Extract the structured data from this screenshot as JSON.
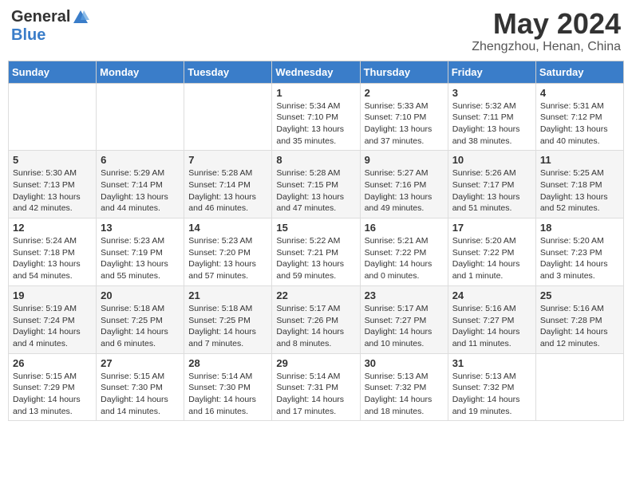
{
  "logo": {
    "general": "General",
    "blue": "Blue"
  },
  "title": "May 2024",
  "location": "Zhengzhou, Henan, China",
  "days_of_week": [
    "Sunday",
    "Monday",
    "Tuesday",
    "Wednesday",
    "Thursday",
    "Friday",
    "Saturday"
  ],
  "weeks": [
    [
      {
        "day": "",
        "info": ""
      },
      {
        "day": "",
        "info": ""
      },
      {
        "day": "",
        "info": ""
      },
      {
        "day": "1",
        "info": "Sunrise: 5:34 AM\nSunset: 7:10 PM\nDaylight: 13 hours\nand 35 minutes."
      },
      {
        "day": "2",
        "info": "Sunrise: 5:33 AM\nSunset: 7:10 PM\nDaylight: 13 hours\nand 37 minutes."
      },
      {
        "day": "3",
        "info": "Sunrise: 5:32 AM\nSunset: 7:11 PM\nDaylight: 13 hours\nand 38 minutes."
      },
      {
        "day": "4",
        "info": "Sunrise: 5:31 AM\nSunset: 7:12 PM\nDaylight: 13 hours\nand 40 minutes."
      }
    ],
    [
      {
        "day": "5",
        "info": "Sunrise: 5:30 AM\nSunset: 7:13 PM\nDaylight: 13 hours\nand 42 minutes."
      },
      {
        "day": "6",
        "info": "Sunrise: 5:29 AM\nSunset: 7:14 PM\nDaylight: 13 hours\nand 44 minutes."
      },
      {
        "day": "7",
        "info": "Sunrise: 5:28 AM\nSunset: 7:14 PM\nDaylight: 13 hours\nand 46 minutes."
      },
      {
        "day": "8",
        "info": "Sunrise: 5:28 AM\nSunset: 7:15 PM\nDaylight: 13 hours\nand 47 minutes."
      },
      {
        "day": "9",
        "info": "Sunrise: 5:27 AM\nSunset: 7:16 PM\nDaylight: 13 hours\nand 49 minutes."
      },
      {
        "day": "10",
        "info": "Sunrise: 5:26 AM\nSunset: 7:17 PM\nDaylight: 13 hours\nand 51 minutes."
      },
      {
        "day": "11",
        "info": "Sunrise: 5:25 AM\nSunset: 7:18 PM\nDaylight: 13 hours\nand 52 minutes."
      }
    ],
    [
      {
        "day": "12",
        "info": "Sunrise: 5:24 AM\nSunset: 7:18 PM\nDaylight: 13 hours\nand 54 minutes."
      },
      {
        "day": "13",
        "info": "Sunrise: 5:23 AM\nSunset: 7:19 PM\nDaylight: 13 hours\nand 55 minutes."
      },
      {
        "day": "14",
        "info": "Sunrise: 5:23 AM\nSunset: 7:20 PM\nDaylight: 13 hours\nand 57 minutes."
      },
      {
        "day": "15",
        "info": "Sunrise: 5:22 AM\nSunset: 7:21 PM\nDaylight: 13 hours\nand 59 minutes."
      },
      {
        "day": "16",
        "info": "Sunrise: 5:21 AM\nSunset: 7:22 PM\nDaylight: 14 hours\nand 0 minutes."
      },
      {
        "day": "17",
        "info": "Sunrise: 5:20 AM\nSunset: 7:22 PM\nDaylight: 14 hours\nand 1 minute."
      },
      {
        "day": "18",
        "info": "Sunrise: 5:20 AM\nSunset: 7:23 PM\nDaylight: 14 hours\nand 3 minutes."
      }
    ],
    [
      {
        "day": "19",
        "info": "Sunrise: 5:19 AM\nSunset: 7:24 PM\nDaylight: 14 hours\nand 4 minutes."
      },
      {
        "day": "20",
        "info": "Sunrise: 5:18 AM\nSunset: 7:25 PM\nDaylight: 14 hours\nand 6 minutes."
      },
      {
        "day": "21",
        "info": "Sunrise: 5:18 AM\nSunset: 7:25 PM\nDaylight: 14 hours\nand 7 minutes."
      },
      {
        "day": "22",
        "info": "Sunrise: 5:17 AM\nSunset: 7:26 PM\nDaylight: 14 hours\nand 8 minutes."
      },
      {
        "day": "23",
        "info": "Sunrise: 5:17 AM\nSunset: 7:27 PM\nDaylight: 14 hours\nand 10 minutes."
      },
      {
        "day": "24",
        "info": "Sunrise: 5:16 AM\nSunset: 7:27 PM\nDaylight: 14 hours\nand 11 minutes."
      },
      {
        "day": "25",
        "info": "Sunrise: 5:16 AM\nSunset: 7:28 PM\nDaylight: 14 hours\nand 12 minutes."
      }
    ],
    [
      {
        "day": "26",
        "info": "Sunrise: 5:15 AM\nSunset: 7:29 PM\nDaylight: 14 hours\nand 13 minutes."
      },
      {
        "day": "27",
        "info": "Sunrise: 5:15 AM\nSunset: 7:30 PM\nDaylight: 14 hours\nand 14 minutes."
      },
      {
        "day": "28",
        "info": "Sunrise: 5:14 AM\nSunset: 7:30 PM\nDaylight: 14 hours\nand 16 minutes."
      },
      {
        "day": "29",
        "info": "Sunrise: 5:14 AM\nSunset: 7:31 PM\nDaylight: 14 hours\nand 17 minutes."
      },
      {
        "day": "30",
        "info": "Sunrise: 5:13 AM\nSunset: 7:32 PM\nDaylight: 14 hours\nand 18 minutes."
      },
      {
        "day": "31",
        "info": "Sunrise: 5:13 AM\nSunset: 7:32 PM\nDaylight: 14 hours\nand 19 minutes."
      },
      {
        "day": "",
        "info": ""
      }
    ]
  ]
}
